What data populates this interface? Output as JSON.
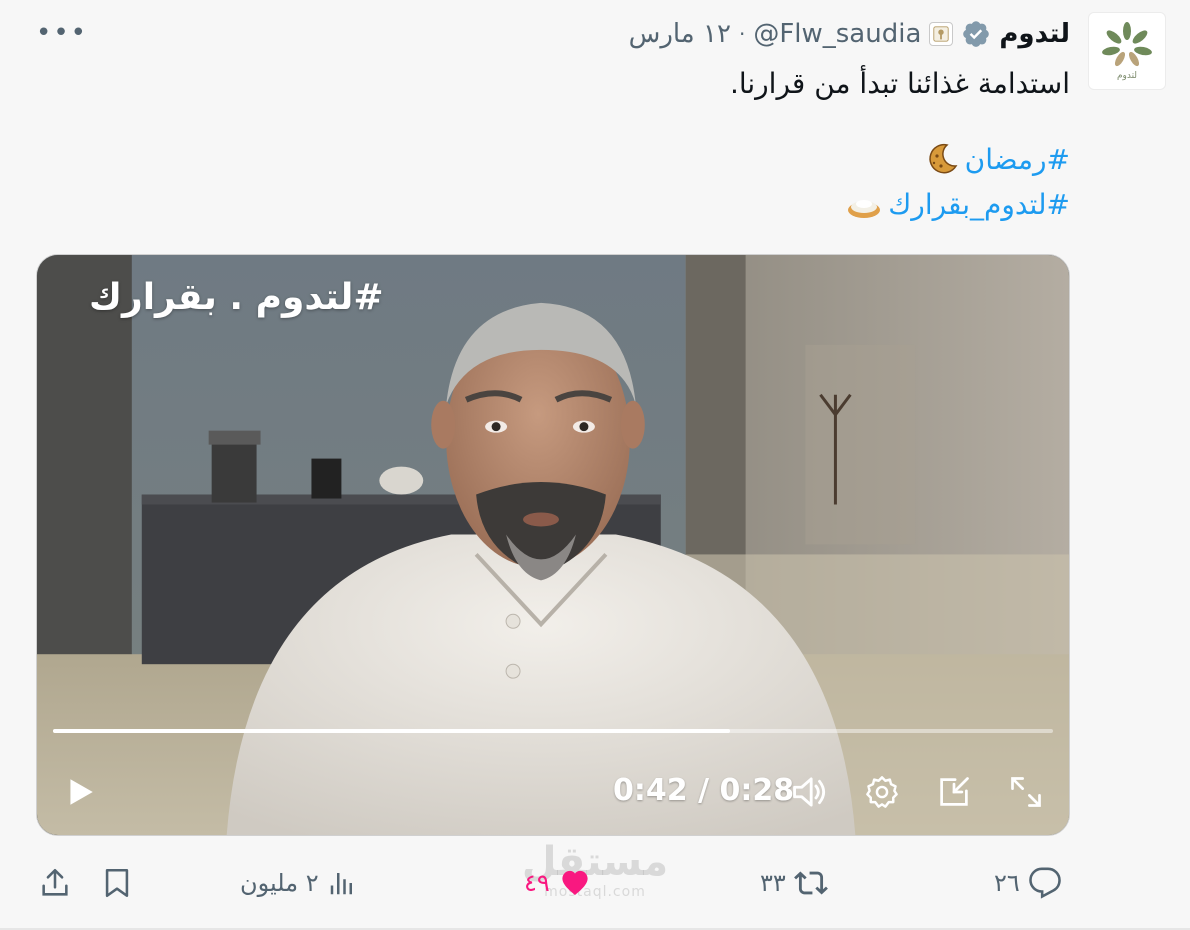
{
  "tweet": {
    "display_name": "لتدوم",
    "handle": "@Flw_saudia",
    "date": "١٢ مارس",
    "separator": "·",
    "avatar_text": "لتدوم",
    "body": "استدامة غذائنا تبدأ من قرارنا.",
    "hashtags": [
      "#رمضان",
      "#لتدوم_بقرارك"
    ],
    "more_label": "•••"
  },
  "video": {
    "overlay_tag": "#لتدوم . بقرارك",
    "time_display": "0:42 / 0:28",
    "progress": 0.677
  },
  "actions": {
    "replies": "٢٦",
    "retweets": "٣٣",
    "likes": "٤٩",
    "views": "٢ مليون"
  },
  "watermark": {
    "text": "مستقل",
    "sub": "mostaql.com"
  },
  "colors": {
    "accent": "#1d9bf0",
    "like": "#f91880",
    "muted": "#536471"
  },
  "icons": [
    "more-icon",
    "verified-icon",
    "affiliation-icon",
    "moon-emoji-icon",
    "dish-emoji-icon",
    "play-icon",
    "volume-icon",
    "settings-icon",
    "pip-icon",
    "fullscreen-icon",
    "reply-icon",
    "retweet-icon",
    "heart-icon",
    "views-icon",
    "bookmark-icon",
    "share-icon"
  ]
}
